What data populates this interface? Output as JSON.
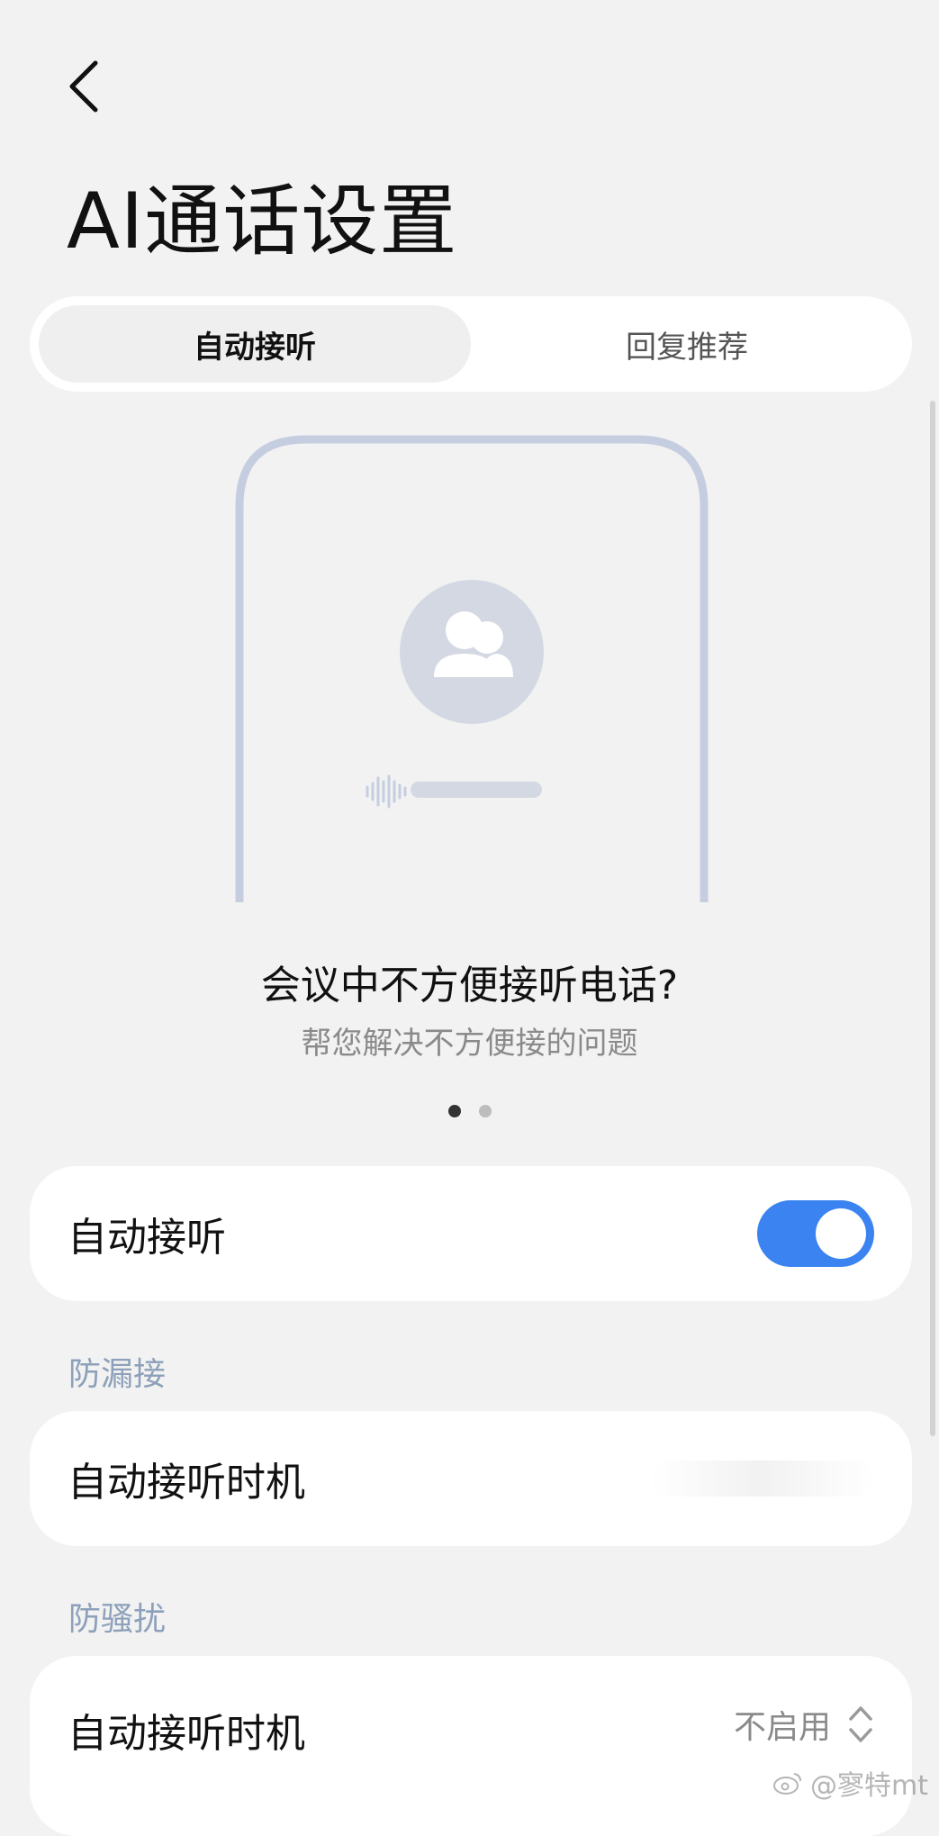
{
  "header": {
    "title": "AI通话设置"
  },
  "tabs": [
    {
      "label": "自动接听",
      "active": true
    },
    {
      "label": "回复推荐",
      "active": false
    }
  ],
  "promo": {
    "title": "会议中不方便接听电话?",
    "subtitle": "帮您解决不方便接的问题",
    "page_count": 2,
    "current_page": 1
  },
  "auto_answer": {
    "label": "自动接听",
    "enabled": true
  },
  "sections": {
    "missed": {
      "header": "防漏接",
      "item_label": "自动接听时机"
    },
    "harassment": {
      "header": "防骚扰",
      "item_label": "自动接听时机",
      "value": "不启用"
    }
  },
  "watermark": {
    "text": "@寥特mt",
    "icon": "weibo-icon"
  },
  "colors": {
    "accent": "#3a83f1",
    "section_header": "#8da0ba",
    "illustration": "#c5cde0"
  }
}
